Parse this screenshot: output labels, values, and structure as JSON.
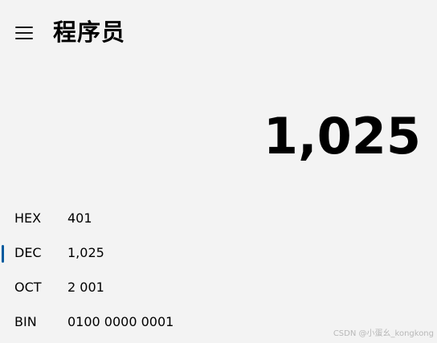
{
  "header": {
    "title": "程序员",
    "menu_icon": "hamburger-menu-icon"
  },
  "display": {
    "value": "1,025"
  },
  "radix": [
    {
      "label": "HEX",
      "value": "401",
      "active": false
    },
    {
      "label": "DEC",
      "value": "1,025",
      "active": true
    },
    {
      "label": "OCT",
      "value": "2 001",
      "active": false
    },
    {
      "label": "BIN",
      "value": "0100 0000 0001",
      "active": false
    }
  ],
  "colors": {
    "background": "#f3f3f3",
    "accent": "#005a9e",
    "text": "#000000"
  },
  "watermark": "CSDN @小蛋幺_kongkong"
}
